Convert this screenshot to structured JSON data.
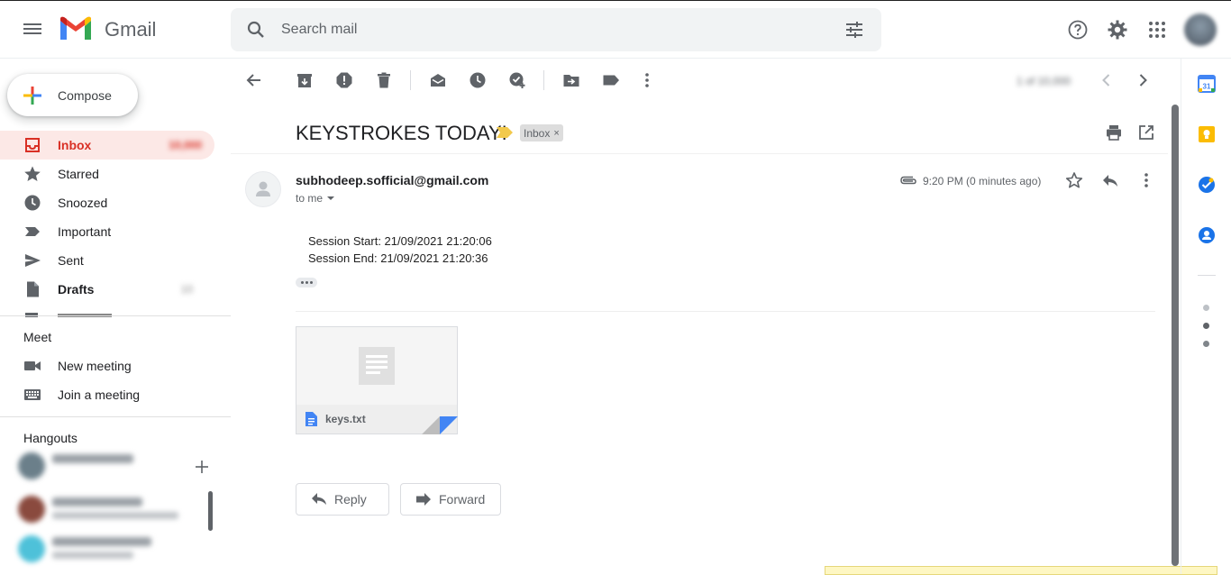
{
  "app": {
    "logo_text": "Gmail",
    "search_placeholder": "Search mail"
  },
  "sidebar": {
    "compose_label": "Compose",
    "items": [
      {
        "label": "Inbox",
        "icon": "inbox-icon"
      },
      {
        "label": "Starred",
        "icon": "star-icon"
      },
      {
        "label": "Snoozed",
        "icon": "clock-icon"
      },
      {
        "label": "Important",
        "icon": "important-icon"
      },
      {
        "label": "Sent",
        "icon": "send-icon"
      },
      {
        "label": "Drafts",
        "icon": "draft-icon"
      }
    ]
  },
  "meet": {
    "title": "Meet",
    "new_meeting": "New meeting",
    "join_meeting": "Join a meeting"
  },
  "hangouts": {
    "title": "Hangouts"
  },
  "message": {
    "subject": "KEYSTROKES TODAY!",
    "label": "Inbox",
    "label_remove": "×",
    "sender": "subhodeep.sofficial@gmail.com",
    "recipient": "to me",
    "timestamp": "9:20 PM (0 minutes ago)",
    "body_lines": [
      "Session Start: 21/09/2021 21:20:06",
      "Session End: 21/09/2021 21:20:36"
    ],
    "attachment_name": "keys.txt",
    "reply_label": "Reply",
    "forward_label": "Forward"
  },
  "colors": {
    "accent_red": "#d93025",
    "active_bg": "#fce8e6",
    "label_bg": "#dddddd",
    "importance_yellow": "#f2c94c"
  }
}
